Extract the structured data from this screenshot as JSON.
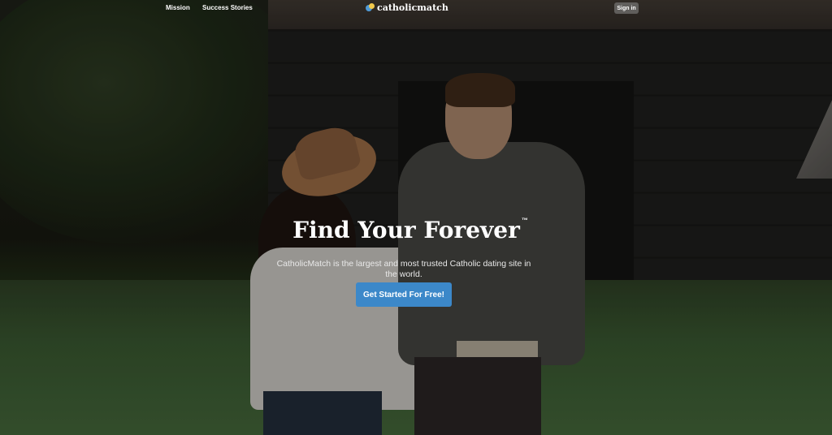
{
  "nav": {
    "mission_label": "Mission",
    "success_stories_label": "Success Stories",
    "logo_text": "catholicmatch",
    "signin_label": "Sign in"
  },
  "hero": {
    "headline": "Find Your Forever",
    "trademark": "™",
    "tagline": "CatholicMatch is the largest and most trusted Catholic dating site in the world.",
    "cta_label": "Get Started For Free!"
  },
  "colors": {
    "cta": "#3c88c9",
    "logo_blue": "#4f9ad6",
    "logo_yellow": "#f2c94c"
  },
  "icons": [
    "catholicmatch-logo-icon"
  ]
}
